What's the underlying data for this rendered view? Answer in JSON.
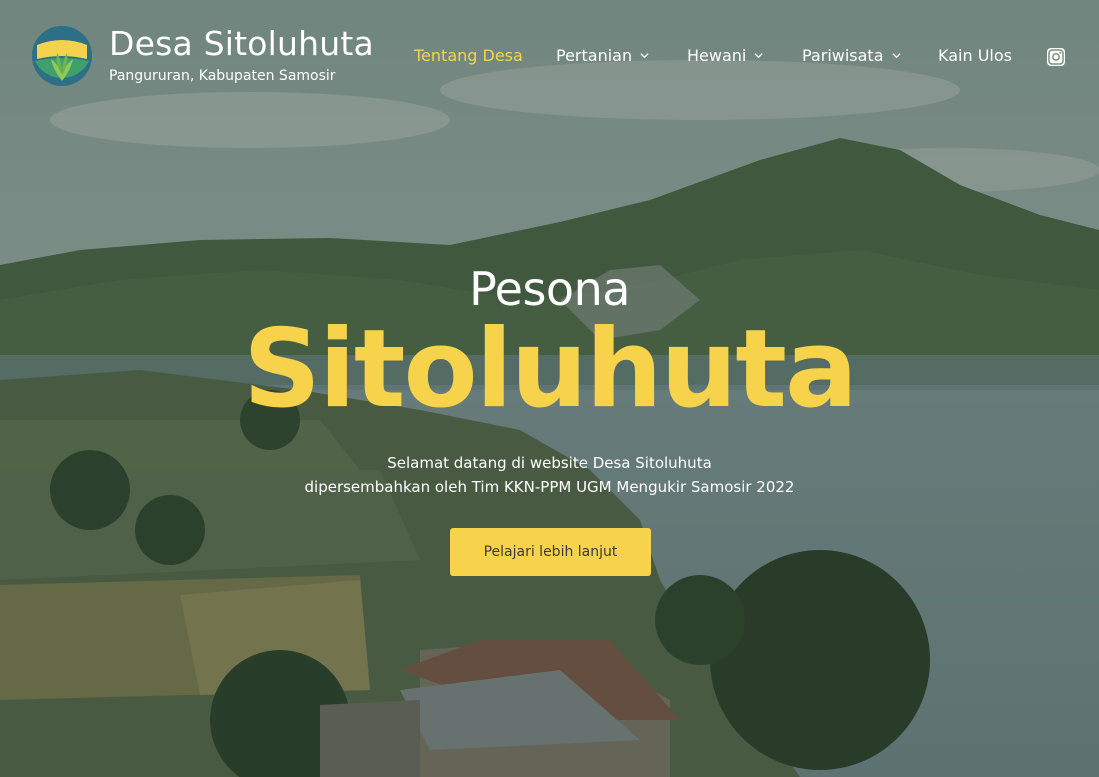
{
  "header": {
    "site_title": "Desa Sitoluhuta",
    "site_tagline": "Pangururan, Kabupaten Samosir",
    "logo_icon": "village-logo-icon"
  },
  "nav": {
    "items": [
      {
        "label": "Tentang Desa",
        "active": true,
        "has_dropdown": false
      },
      {
        "label": "Pertanian",
        "active": false,
        "has_dropdown": true
      },
      {
        "label": "Hewani",
        "active": false,
        "has_dropdown": true
      },
      {
        "label": "Pariwisata",
        "active": false,
        "has_dropdown": true
      },
      {
        "label": "Kain Ulos",
        "active": false,
        "has_dropdown": false
      }
    ],
    "social_icon": "instagram-icon"
  },
  "hero": {
    "kicker": "Pesona",
    "headline": "Sitoluhuta",
    "description_line1": "Selamat datang di website Desa Sitoluhuta",
    "description_line2": "dipersembahkan oleh Tim KKN-PPM UGM Mengukir Samosir 2022",
    "cta_label": "Pelajari lebih lanjut"
  },
  "colors": {
    "accent": "#f6d34a",
    "text": "#ffffff"
  }
}
